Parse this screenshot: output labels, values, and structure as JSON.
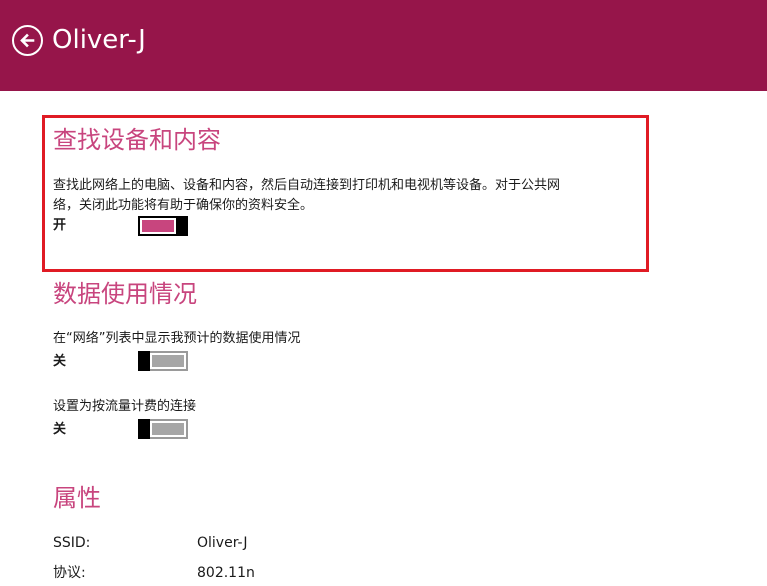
{
  "header": {
    "title": "Oliver-J",
    "back_icon": "back-arrow-circle-icon",
    "background_color": "#96154a"
  },
  "sections": {
    "find_devices": {
      "title": "查找设备和内容",
      "description_line1": "查找此网络上的电脑、设备和内容，然后自动连接到打印机和电视机等设备。对于公共网",
      "description_line2": "络，关闭此功能将有助于确保你的资料安全。",
      "toggle_state": "开",
      "toggle_on": true
    },
    "data_usage": {
      "title": "数据使用情况",
      "estimate_label": "在“网络”列表中显示我预计的数据使用情况",
      "estimate_state": "关",
      "estimate_on": false,
      "metered_label": "设置为按流量计费的连接",
      "metered_state": "关",
      "metered_on": false
    },
    "properties": {
      "title": "属性",
      "ssid_label": "SSID:",
      "ssid_value": "Oliver-J",
      "protocol_label": "协议:",
      "protocol_value": "802.11n"
    }
  },
  "colors": {
    "accent": "#c8457e",
    "highlight_border": "#e01b24"
  }
}
